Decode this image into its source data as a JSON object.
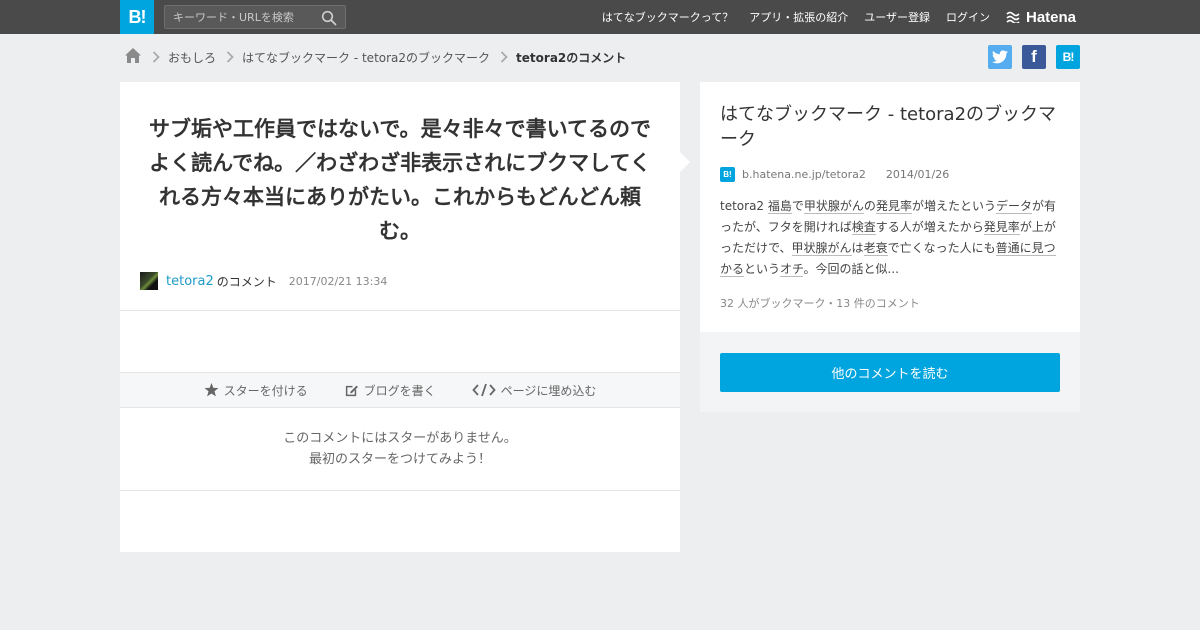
{
  "topbar": {
    "logo_text": "B!",
    "search_placeholder": "キーワード・URLを検索",
    "nav": [
      "はてなブックマークって？",
      "アプリ・拡張の紹介",
      "ユーザー登録",
      "ログイン"
    ],
    "brand": "Hatena"
  },
  "breadcrumb": {
    "items": [
      "おもしろ",
      "はてなブックマーク - tetora2のブックマーク"
    ],
    "current": "tetora2のコメント"
  },
  "social": {
    "facebook_glyph": "f",
    "hatena_glyph": "B!"
  },
  "comment": {
    "text": "サブ垢や工作員ではないで。是々非々で書いてるのでよく読んでね。／わざわざ非表示されにブクマしてくれる方々本当にありがたい。これからもどんどん頼む。",
    "user": "tetora2",
    "suffix": "のコメント",
    "date": "2017/02/21 13:34"
  },
  "actions": {
    "star": "スターを付ける",
    "blog": "ブログを書く",
    "embed": "ページに埋め込む"
  },
  "no_star": {
    "line1": "このコメントにはスターがありません。",
    "line2": "最初のスターをつけてみよう！"
  },
  "entry": {
    "title": "はてなブックマーク - tetora2のブックマーク",
    "mini_logo": "B!",
    "domain": "b.hatena.ne.jp/tetora2",
    "date": "2014/01/26",
    "excerpt": [
      {
        "t": "tetora2 "
      },
      {
        "t": "福島",
        "kw": true
      },
      {
        "t": "で"
      },
      {
        "t": "甲状腺がん",
        "kw": true
      },
      {
        "t": "の"
      },
      {
        "t": "発見率",
        "kw": true
      },
      {
        "t": "が増えたという"
      },
      {
        "t": "データ",
        "kw": true
      },
      {
        "t": "が有ったが、フタを開ければ"
      },
      {
        "t": "検査",
        "kw": true
      },
      {
        "t": "する人が増えたから"
      },
      {
        "t": "発見率",
        "kw": true
      },
      {
        "t": "が上がっただけで、"
      },
      {
        "t": "甲状腺がん",
        "kw": true
      },
      {
        "t": "は"
      },
      {
        "t": "老衰",
        "kw": true
      },
      {
        "t": "で亡くなった人にも"
      },
      {
        "t": "普通に見つかる",
        "kw": true
      },
      {
        "t": "という"
      },
      {
        "t": "オチ",
        "kw": true
      },
      {
        "t": "。今回の話と似..."
      }
    ],
    "count": "32 人がブックマーク・13 件のコメント",
    "read_button": "他のコメントを読む"
  }
}
